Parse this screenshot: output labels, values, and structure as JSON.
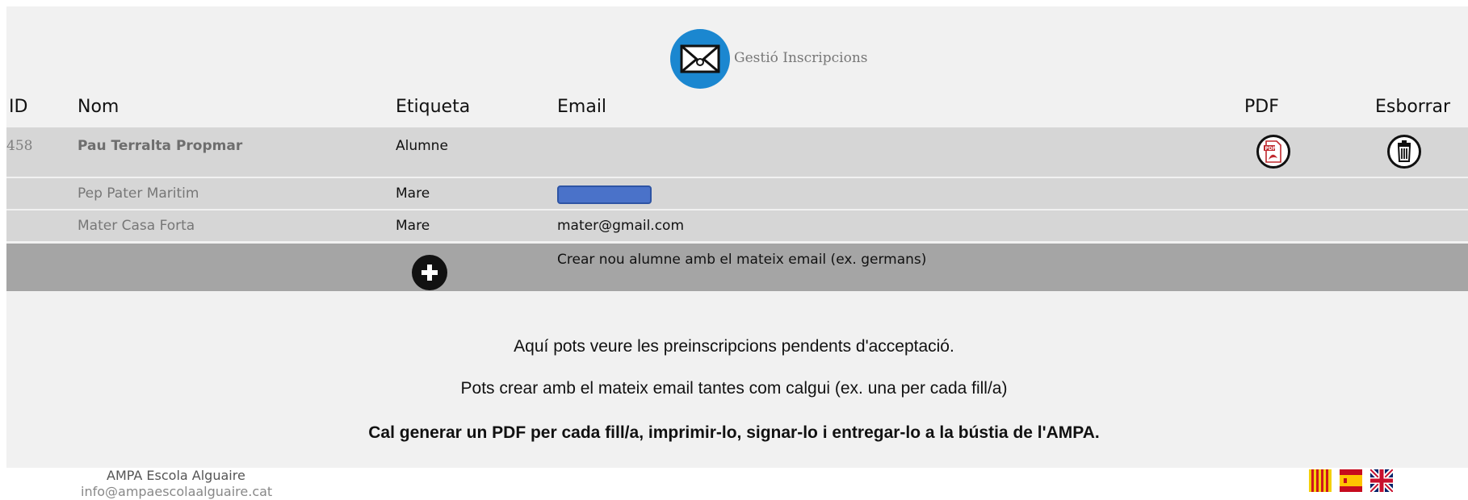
{
  "header": {
    "title": "Gestió Inscripcions",
    "logo_icon": "envelope-icon"
  },
  "columns": {
    "id": "ID",
    "nom": "Nom",
    "etiqueta": "Etiqueta",
    "email": "Email",
    "pdf": "PDF",
    "esborrar": "Esborrar"
  },
  "rows": [
    {
      "id": "458",
      "nom": "Pau Terralta Propmar",
      "etiqueta": "Alumne",
      "email": ""
    },
    {
      "id": "",
      "nom": "Pep Pater Maritim",
      "etiqueta": "Mare",
      "email": ""
    },
    {
      "id": "",
      "nom": "Mater Casa Forta",
      "etiqueta": "Mare",
      "email": "mater@gmail.com"
    }
  ],
  "add_row": {
    "label": "Crear nou alumne amb el mateix email (ex. germans)",
    "icon": "plus-circle-icon"
  },
  "info": {
    "line1": "Aquí pots veure les preinscripcions pendents d'acceptació.",
    "line2": "Pots crear amb el mateix email tantes com calgui (ex. una per cada fill/a)",
    "line3": "Cal generar un PDF per cada fill/a, imprimir-lo, signar-lo i entregar-lo a la bústia de l'AMPA."
  },
  "footer": {
    "name": "AMPA Escola Alguaire",
    "email": "info@ampaescolaalguaire.cat"
  },
  "languages": [
    "catalan-flag-icon",
    "spanish-flag-icon",
    "uk-flag-icon"
  ],
  "colors": {
    "accent": "#1b87d0",
    "row": "#d6d6d6",
    "add_row": "#a5a5a5",
    "panel": "#f1f1f1"
  }
}
